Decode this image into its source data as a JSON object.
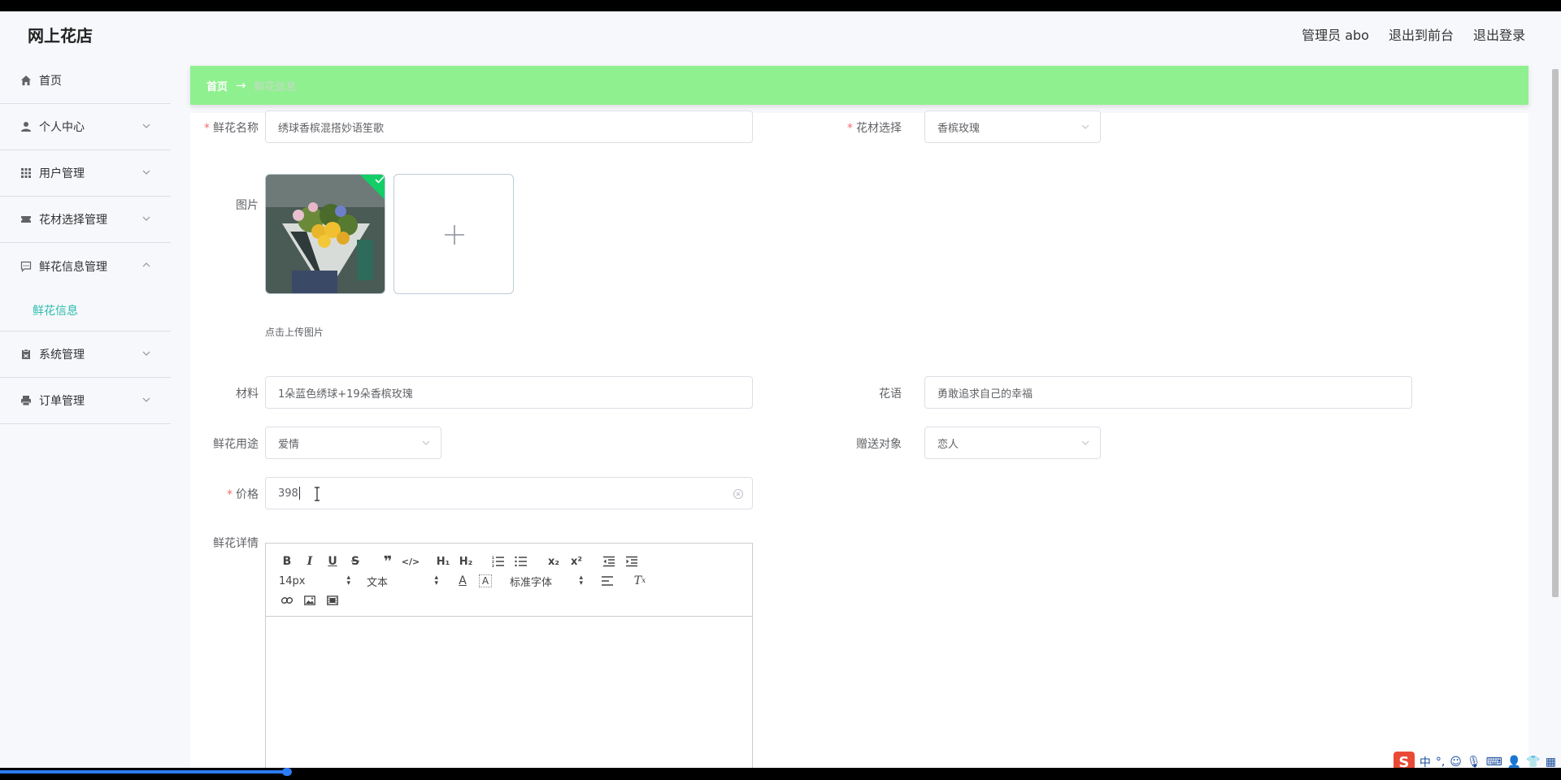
{
  "header": {
    "site_title": "网上花店",
    "admin_label": "管理员 abo",
    "front_label": "退出到前台",
    "logout_label": "退出登录"
  },
  "sidebar": {
    "items": [
      {
        "label": "首页",
        "icon": "home-icon"
      },
      {
        "label": "个人中心",
        "icon": "user-icon"
      },
      {
        "label": "用户管理",
        "icon": "grid-icon"
      },
      {
        "label": "花材选择管理",
        "icon": "ticket-icon"
      },
      {
        "label": "鲜花信息管理",
        "icon": "chat-icon"
      },
      {
        "label": "系统管理",
        "icon": "clipboard-icon"
      },
      {
        "label": "订单管理",
        "icon": "printer-icon"
      }
    ],
    "active_submenu": "鲜花信息"
  },
  "breadcrumb": {
    "home": "首页",
    "arrow": "→",
    "current": "鲜花信息"
  },
  "form": {
    "flower_name_label": "鲜花名称",
    "flower_name_value": "绣球香槟混搭妙语笙歌",
    "material_choice_label": "花材选择",
    "material_choice_value": "香槟玫瑰",
    "image_label": "图片",
    "upload_tip": "点击上传图片",
    "material_label": "材料",
    "material_value": "1朵蓝色绣球+19朵香槟玫瑰",
    "flower_language_label": "花语",
    "flower_language_value": "勇敢追求自己的幸福",
    "usage_label": "鲜花用途",
    "usage_value": "爱情",
    "recipient_label": "赠送对象",
    "recipient_value": "恋人",
    "price_label": "价格",
    "price_value": "398",
    "detail_label": "鲜花详情",
    "required_mark": "*"
  },
  "editor": {
    "font_size": "14px",
    "block_format": "文本",
    "font_family": "标准字体"
  },
  "colors": {
    "accent": "#2bbbad",
    "breadcrumb_bg": "#8ff08f",
    "required": "#f56c6c",
    "success": "#13ce66"
  }
}
